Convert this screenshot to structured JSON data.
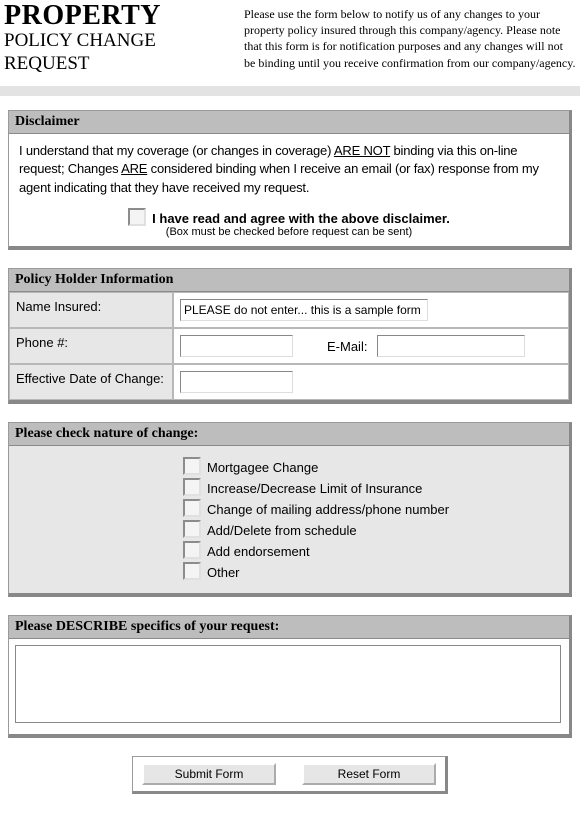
{
  "header": {
    "title": "PROPERTY",
    "subtitle": "POLICY CHANGE REQUEST",
    "intro": "Please use the form below to notify us of any changes to your property policy insured through this company/agency. Please note that this form is for notification purposes and any changes will not be binding until you receive confirmation from our company/agency."
  },
  "disclaimer": {
    "heading": "Disclaimer",
    "text_pre": "I understand that my coverage (or changes in coverage) ",
    "u1": "ARE NOT",
    "text_mid": " binding via this on-line request; Changes ",
    "u2": "ARE",
    "text_post": " considered binding when I receive an email (or fax) response from my agent indicating that they have received my request.",
    "agree": "I have read and agree with the above disclaimer.",
    "note": "(Box must be checked before request can be sent)"
  },
  "policy": {
    "heading": "Policy Holder Information",
    "name_label": "Name Insured:",
    "name_value": "PLEASE do not enter... this is a sample form",
    "phone_label": "Phone #:",
    "phone_value": "",
    "email_label": "E-Mail:",
    "email_value": "",
    "date_label": "Effective Date of Change:",
    "date_value": ""
  },
  "nature": {
    "heading": "Please check nature of change:",
    "items": [
      "Mortgagee Change",
      "Increase/Decrease Limit of Insurance",
      "Change of mailing address/phone number",
      "Add/Delete from schedule",
      "Add endorsement",
      "Other"
    ]
  },
  "describe": {
    "heading": "Please DESCRIBE specifics of your request:",
    "value": ""
  },
  "buttons": {
    "submit": "Submit Form",
    "reset": "Reset Form"
  }
}
